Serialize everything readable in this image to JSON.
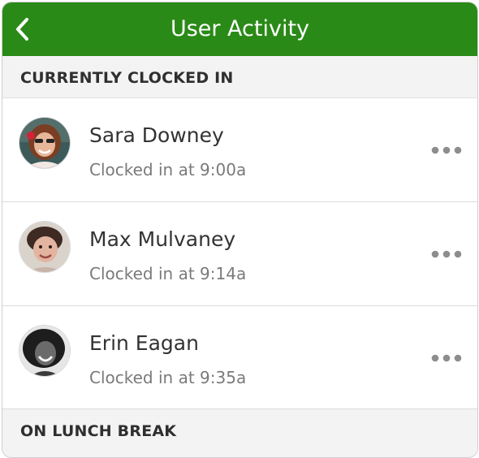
{
  "header": {
    "title": "User Activity",
    "back_icon": "chevron-left-icon"
  },
  "sections": [
    {
      "label": "CURRENTLY CLOCKED IN",
      "users": [
        {
          "name": "Sara Downey",
          "status": "Clocked in at 9:00a"
        },
        {
          "name": "Max Mulvaney",
          "status": "Clocked in at 9:14a"
        },
        {
          "name": "Erin Eagan",
          "status": "Clocked in at 9:35a"
        }
      ]
    },
    {
      "label": "ON LUNCH BREAK",
      "users": []
    }
  ],
  "more_icon": "more-horizontal-icon",
  "colors": {
    "header_bg": "#2a8a17",
    "section_bg": "#f3f3f3",
    "name_text": "#333333",
    "status_text": "#7a7a7a"
  }
}
